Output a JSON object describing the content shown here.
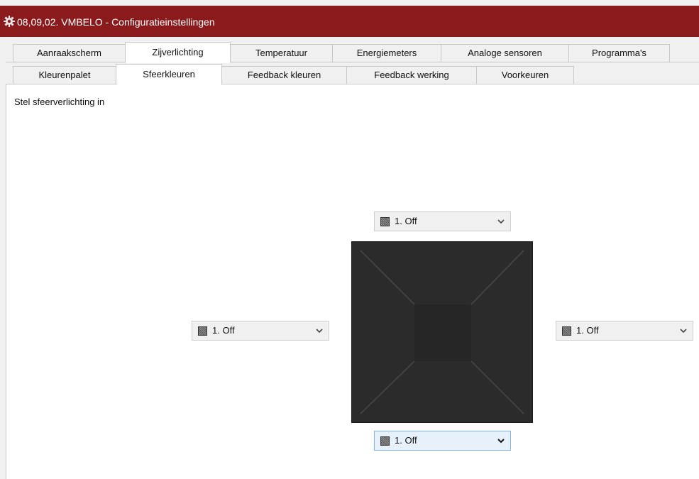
{
  "window": {
    "title": "08,09,02. VMBELO - Configuratieinstellingen",
    "title_bar_color": "#8b1a1c",
    "icon": "gear-icon"
  },
  "tabs_top": [
    {
      "label": "Aanraakscherm",
      "active": false
    },
    {
      "label": "Zijverlichting",
      "active": true
    },
    {
      "label": "Temperatuur",
      "active": false
    },
    {
      "label": "Energiemeters",
      "active": false
    },
    {
      "label": "Analoge sensoren",
      "active": false
    },
    {
      "label": "Programma's",
      "active": false
    }
  ],
  "tabs_sub": [
    {
      "label": "Kleurenpalet",
      "active": false
    },
    {
      "label": "Sfeerkleuren",
      "active": true
    },
    {
      "label": "Feedback kleuren",
      "active": false
    },
    {
      "label": "Feedback werking",
      "active": false
    },
    {
      "label": "Voorkeuren",
      "active": false
    }
  ],
  "panel": {
    "caption": "Stel sfeerverlichting in"
  },
  "selects": {
    "top": {
      "value": "1. Off"
    },
    "left": {
      "value": "1. Off"
    },
    "right": {
      "value": "1. Off"
    },
    "bottom": {
      "value": "1. Off"
    }
  },
  "preview": {
    "color": "#2b2b2b"
  }
}
